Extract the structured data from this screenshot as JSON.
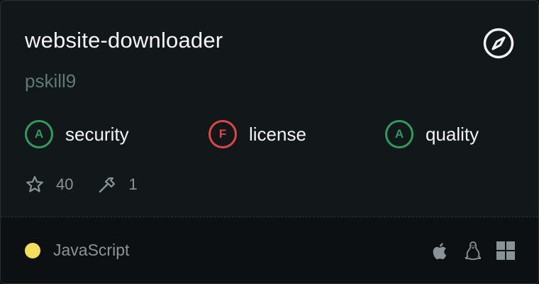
{
  "repo": {
    "name": "website-downloader",
    "owner": "pskill9"
  },
  "icons": {
    "explore": "compass-icon",
    "stars": "star-icon",
    "tools": "hammer-icon",
    "platforms": [
      "apple-icon",
      "linux-icon",
      "windows-icon"
    ]
  },
  "scores": [
    {
      "grade": "A",
      "label": "security",
      "status": "pass"
    },
    {
      "grade": "F",
      "label": "license",
      "status": "fail"
    },
    {
      "grade": "A",
      "label": "quality",
      "status": "pass"
    }
  ],
  "stats": {
    "stars": "40",
    "tools": "1"
  },
  "language": {
    "name": "JavaScript",
    "color": "#f2e05c"
  },
  "colors": {
    "pass": "#2e9b5f",
    "fail": "#e04646",
    "owner_text": "#5d7a76",
    "muted_text": "#8a9398"
  }
}
